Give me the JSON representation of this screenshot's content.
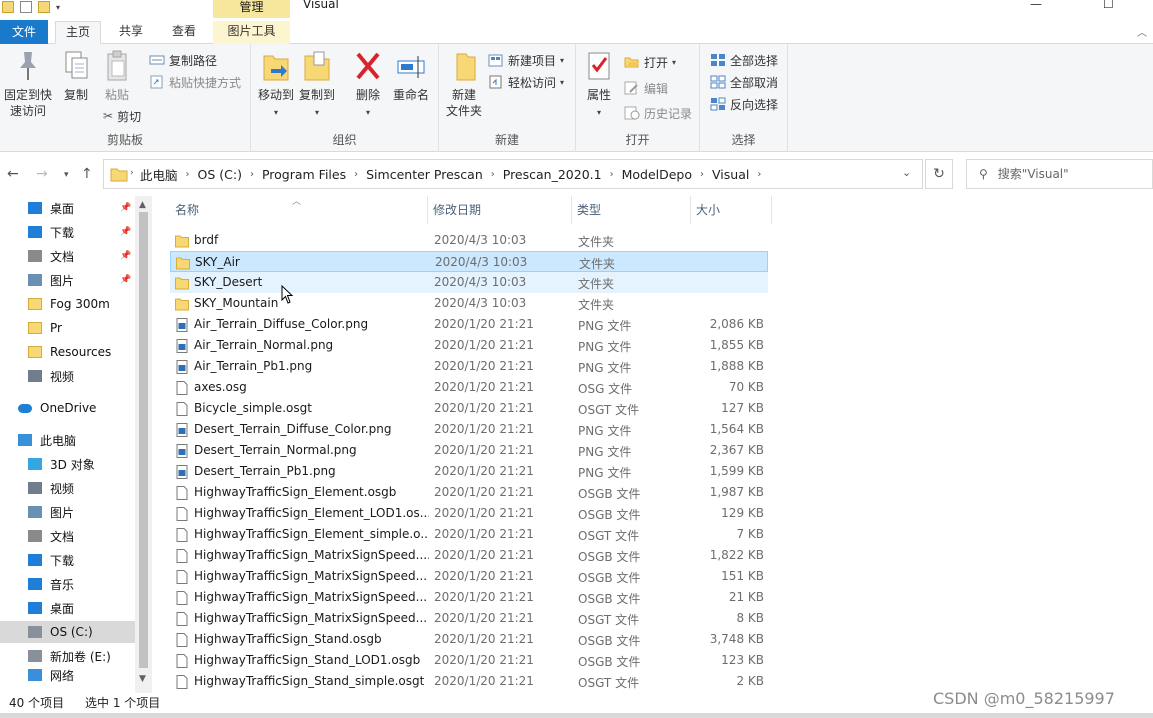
{
  "window": {
    "title": "Visual",
    "manage_tab": "管理",
    "min_glyph": "—",
    "max_glyph": "☐"
  },
  "tabs": {
    "file": "文件",
    "home": "主页",
    "share": "共享",
    "view": "查看",
    "picture_tools": "图片工具"
  },
  "ribbon": {
    "clipboard": {
      "label": "剪贴板",
      "pin_line1": "固定到快",
      "pin_line2": "速访问",
      "copy": "复制",
      "paste": "粘贴",
      "copy_path": "复制路径",
      "paste_shortcut": "粘贴快捷方式",
      "cut": "剪切"
    },
    "organize": {
      "label": "组织",
      "move_to": "移动到",
      "copy_to": "复制到",
      "delete": "删除",
      "rename": "重命名"
    },
    "new": {
      "label": "新建",
      "new_folder_line1": "新建",
      "new_folder_line2": "文件夹",
      "new_item": "新建项目",
      "easy_access": "轻松访问"
    },
    "open": {
      "label": "打开",
      "properties": "属性",
      "open": "打开",
      "edit": "编辑",
      "history": "历史记录"
    },
    "select": {
      "label": "选择",
      "select_all": "全部选择",
      "select_none": "全部取消",
      "invert": "反向选择"
    }
  },
  "address": {
    "crumbs": [
      "此电脑",
      "OS (C:)",
      "Program Files",
      "Simcenter Prescan",
      "Prescan_2020.1",
      "ModelDepo",
      "Visual"
    ],
    "search_placeholder": "搜索\"Visual\""
  },
  "nav": {
    "items": [
      {
        "label": "桌面",
        "icon": "desktop-icon",
        "pinned": true
      },
      {
        "label": "下载",
        "icon": "download-icon",
        "pinned": true
      },
      {
        "label": "文档",
        "icon": "documents-icon",
        "pinned": true
      },
      {
        "label": "图片",
        "icon": "pictures-icon",
        "pinned": true
      },
      {
        "label": "Fog 300m",
        "icon": "folder-icon",
        "pinned": false
      },
      {
        "label": "Pr",
        "icon": "folder-icon",
        "pinned": false
      },
      {
        "label": "Resources",
        "icon": "folder-icon",
        "pinned": false
      },
      {
        "label": "视频",
        "icon": "videos-icon",
        "pinned": false
      },
      {
        "label": "OneDrive",
        "icon": "onedrive-icon",
        "pinned": false
      },
      {
        "label": "此电脑",
        "icon": "this-pc-icon",
        "pinned": false
      },
      {
        "label": "3D 对象",
        "icon": "3d-objects-icon",
        "pinned": false
      },
      {
        "label": "视频",
        "icon": "videos-icon",
        "pinned": false
      },
      {
        "label": "图片",
        "icon": "pictures-icon",
        "pinned": false
      },
      {
        "label": "文档",
        "icon": "documents-icon",
        "pinned": false
      },
      {
        "label": "下载",
        "icon": "download-icon",
        "pinned": false
      },
      {
        "label": "音乐",
        "icon": "music-icon",
        "pinned": false
      },
      {
        "label": "桌面",
        "icon": "desktop-icon",
        "pinned": false
      },
      {
        "label": "OS (C:)",
        "icon": "drive-icon",
        "pinned": false
      },
      {
        "label": "新加卷 (E:)",
        "icon": "drive-icon",
        "pinned": false
      },
      {
        "label": "网络",
        "icon": "network-icon",
        "pinned": false
      }
    ]
  },
  "columns": {
    "name": "名称",
    "date": "修改日期",
    "type": "类型",
    "size": "大小"
  },
  "files": [
    {
      "name": "brdf",
      "date": "2020/4/3 10:03",
      "type": "文件夹",
      "size": "",
      "kind": "folder"
    },
    {
      "name": "SKY_Air",
      "date": "2020/4/3 10:03",
      "type": "文件夹",
      "size": "",
      "kind": "folder"
    },
    {
      "name": "SKY_Desert",
      "date": "2020/4/3 10:03",
      "type": "文件夹",
      "size": "",
      "kind": "folder"
    },
    {
      "name": "SKY_Mountain",
      "date": "2020/4/3 10:03",
      "type": "文件夹",
      "size": "",
      "kind": "folder"
    },
    {
      "name": "Air_Terrain_Diffuse_Color.png",
      "date": "2020/1/20 21:21",
      "type": "PNG 文件",
      "size": "2,086 KB",
      "kind": "image"
    },
    {
      "name": "Air_Terrain_Normal.png",
      "date": "2020/1/20 21:21",
      "type": "PNG 文件",
      "size": "1,855 KB",
      "kind": "image"
    },
    {
      "name": "Air_Terrain_Pb1.png",
      "date": "2020/1/20 21:21",
      "type": "PNG 文件",
      "size": "1,888 KB",
      "kind": "image"
    },
    {
      "name": "axes.osg",
      "date": "2020/1/20 21:21",
      "type": "OSG 文件",
      "size": "70 KB",
      "kind": "file"
    },
    {
      "name": "Bicycle_simple.osgt",
      "date": "2020/1/20 21:21",
      "type": "OSGT 文件",
      "size": "127 KB",
      "kind": "file"
    },
    {
      "name": "Desert_Terrain_Diffuse_Color.png",
      "date": "2020/1/20 21:21",
      "type": "PNG 文件",
      "size": "1,564 KB",
      "kind": "image"
    },
    {
      "name": "Desert_Terrain_Normal.png",
      "date": "2020/1/20 21:21",
      "type": "PNG 文件",
      "size": "2,367 KB",
      "kind": "image"
    },
    {
      "name": "Desert_Terrain_Pb1.png",
      "date": "2020/1/20 21:21",
      "type": "PNG 文件",
      "size": "1,599 KB",
      "kind": "image"
    },
    {
      "name": "HighwayTrafficSign_Element.osgb",
      "date": "2020/1/20 21:21",
      "type": "OSGB 文件",
      "size": "1,987 KB",
      "kind": "file"
    },
    {
      "name": "HighwayTrafficSign_Element_LOD1.os...",
      "date": "2020/1/20 21:21",
      "type": "OSGB 文件",
      "size": "129 KB",
      "kind": "file"
    },
    {
      "name": "HighwayTrafficSign_Element_simple.o...",
      "date": "2020/1/20 21:21",
      "type": "OSGT 文件",
      "size": "7 KB",
      "kind": "file"
    },
    {
      "name": "HighwayTrafficSign_MatrixSignSpeed....",
      "date": "2020/1/20 21:21",
      "type": "OSGB 文件",
      "size": "1,822 KB",
      "kind": "file"
    },
    {
      "name": "HighwayTrafficSign_MatrixSignSpeed...",
      "date": "2020/1/20 21:21",
      "type": "OSGB 文件",
      "size": "151 KB",
      "kind": "file"
    },
    {
      "name": "HighwayTrafficSign_MatrixSignSpeed...",
      "date": "2020/1/20 21:21",
      "type": "OSGB 文件",
      "size": "21 KB",
      "kind": "file"
    },
    {
      "name": "HighwayTrafficSign_MatrixSignSpeed...",
      "date": "2020/1/20 21:21",
      "type": "OSGT 文件",
      "size": "8 KB",
      "kind": "file"
    },
    {
      "name": "HighwayTrafficSign_Stand.osgb",
      "date": "2020/1/20 21:21",
      "type": "OSGB 文件",
      "size": "3,748 KB",
      "kind": "file"
    },
    {
      "name": "HighwayTrafficSign_Stand_LOD1.osgb",
      "date": "2020/1/20 21:21",
      "type": "OSGB 文件",
      "size": "123 KB",
      "kind": "file"
    },
    {
      "name": "HighwayTrafficSign_Stand_simple.osgt",
      "date": "2020/1/20 21:21",
      "type": "OSGT 文件",
      "size": "2 KB",
      "kind": "file"
    }
  ],
  "status": {
    "count": "40 个项目",
    "selected": "选中 1 个项目"
  },
  "watermark": "CSDN @m0_58215997",
  "colors": {
    "accent": "#1979ca",
    "selection": "#cce8ff",
    "hover": "#e5f3ff",
    "folder": "#f8d775"
  }
}
